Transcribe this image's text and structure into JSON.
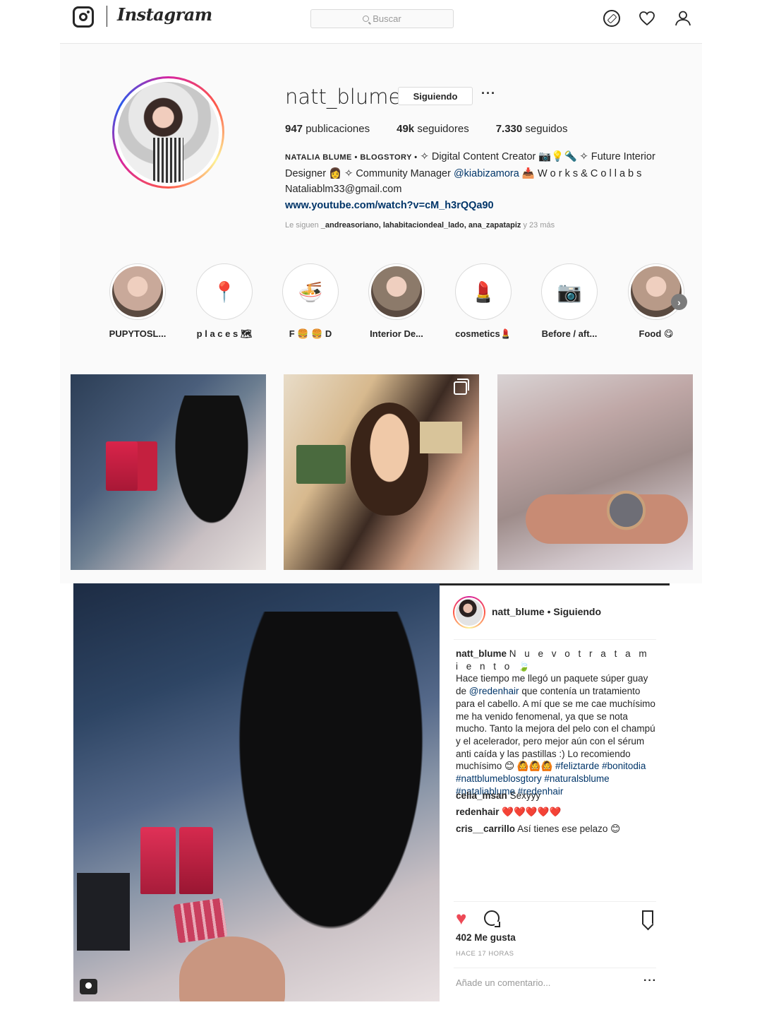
{
  "nav": {
    "wordmark": "Instagram",
    "search_placeholder": "Buscar",
    "icons": [
      "instagram-camera-icon",
      "compass-icon",
      "heart-icon",
      "user-icon"
    ]
  },
  "profile": {
    "username": "natt_blume",
    "follow_button": "Siguiendo",
    "more": "···",
    "stats": {
      "posts_count": "947",
      "posts_label": "publicaciones",
      "followers_count": "49k",
      "followers_label": "seguidores",
      "following_count": "7.330",
      "following_label": "seguidos"
    },
    "bio": {
      "name": "NATALIA BLUME • BLOGSTORY •",
      "line1": "✧ Digital Content Creator 📷💡🔦 ✧ Future Interior Designer 👩 ✧ Community Manager",
      "mention": "@kiabizamora",
      "line1_tail": "📥 W o r k s & C o l l a b s",
      "email": "Nataliablm33@gmail.com",
      "link": "www.youtube.com/watch?v=cM_h3rQQa90"
    },
    "followed_by": {
      "prefix": "Le siguen",
      "users": "_andreasoriano, lahabitaciondeal_lado, ana_zapatapiz",
      "suffix": "y 23 más"
    }
  },
  "highlights": [
    {
      "label": "PUPYTOSL...",
      "icon": "couple-photo",
      "bg": "#c9a99a"
    },
    {
      "label": "p l a c e s 🗺",
      "icon": "location-pin-icon",
      "glyph": "📍",
      "bg": "#ffffff"
    },
    {
      "label": "F 🍔 🍔 D",
      "icon": "noodle-bowl-icon",
      "glyph": "🍜",
      "bg": "#ffffff"
    },
    {
      "label": "Interior De...",
      "icon": "interior-photo",
      "bg": "#8c7a6a"
    },
    {
      "label": "cosmetics💄",
      "icon": "lipstick-icon",
      "glyph": "💄",
      "bg": "#ffffff"
    },
    {
      "label": "Before / aft...",
      "icon": "camera-instax-icon",
      "glyph": "📷",
      "bg": "#ffffff"
    },
    {
      "label": "Food 😋",
      "icon": "selfie-photo",
      "bg": "#b89a88"
    }
  ],
  "post": {
    "author": "natt_blume",
    "follow_state": "Siguiendo",
    "caption_user": "natt_blume",
    "caption_title": "N u e v o t r a t a m i e n t o 🍃",
    "caption_text1": "Hace tiempo me llegó un paquete súper guay de",
    "caption_mention": "@redenhair",
    "caption_text2": "que contenía un tratamiento para el cabello. A mí que se me cae muchísimo me ha venido fenomenal, ya que se nota mucho. Tanto la mejora del pelo con el champú y el acelerador, pero mejor aún con el sérum anti caída y las pastillas :) Lo recomiendo muchísimo 😊 🙆🙆🙆",
    "hashtags": "#feliztarde #bonitodia #nattblumeblosgtory #naturalsblume #nataliablume #redenhair",
    "comments": [
      {
        "user": "celia_msan",
        "text": "Sexyyy"
      },
      {
        "user": "redenhair",
        "text": "❤️❤️❤️❤️❤️"
      },
      {
        "user": "cris__carrillo",
        "text": "Así tienes ese pelazo 😊"
      }
    ],
    "likes": "402 Me gusta",
    "time": "HACE 17 HORAS",
    "comment_placeholder": "Añade un comentario...",
    "more": "···"
  }
}
